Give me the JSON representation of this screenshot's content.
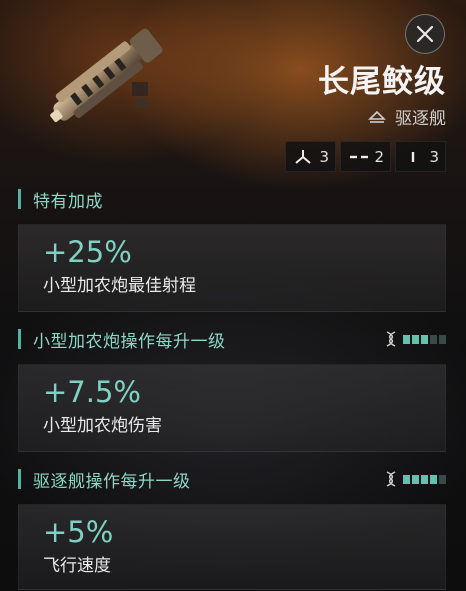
{
  "ship": {
    "name": "长尾鲛级",
    "class_label": "驱逐舰",
    "slots": [
      {
        "icon": "high-slot-icon",
        "count": "3"
      },
      {
        "icon": "mid-slot-icon",
        "count": "2"
      },
      {
        "icon": "low-slot-icon",
        "count": "3"
      }
    ]
  },
  "sections": [
    {
      "title": "特有加成",
      "bonus_value": "+25%",
      "bonus_desc": "小型加农炮最佳射程",
      "skill_level": null
    },
    {
      "title": "小型加农炮操作每升一级",
      "bonus_value": "+7.5%",
      "bonus_desc": "小型加农炮伤害",
      "skill_level": 3,
      "skill_max": 5
    },
    {
      "title": "驱逐舰操作每升一级",
      "bonus_value": "+5%",
      "bonus_desc": "飞行速度",
      "skill_level": 4,
      "skill_max": 5
    }
  ],
  "colors": {
    "accent": "#7fd2c3",
    "header": "#8cd6c6",
    "bar": "#4fb4a4"
  },
  "icons": {
    "close": "close-icon",
    "ship_class": "destroyer-class-icon",
    "skill": "skill-helix-icon"
  }
}
